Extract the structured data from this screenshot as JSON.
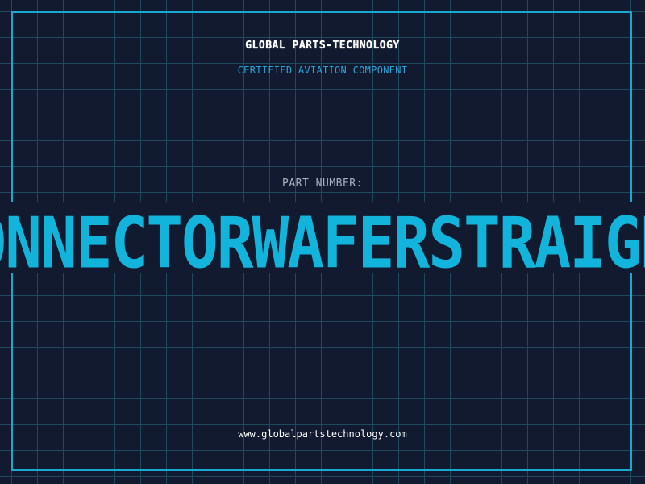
{
  "header": {
    "company": "GLOBAL PARTS-TECHNOLOGY",
    "subtitle": "CERTIFIED AVIATION COMPONENT"
  },
  "part": {
    "label": "PART NUMBER:",
    "value": "CONNECTORWAFERSTRAIGHT"
  },
  "footer": {
    "url": "www.globalpartstechnology.com"
  },
  "colors": {
    "background": "#111a2e",
    "grid": "#1f4a5e",
    "frame": "#18a8d0",
    "accent": "#12b4dc",
    "subtitle": "#2aa4d8"
  }
}
